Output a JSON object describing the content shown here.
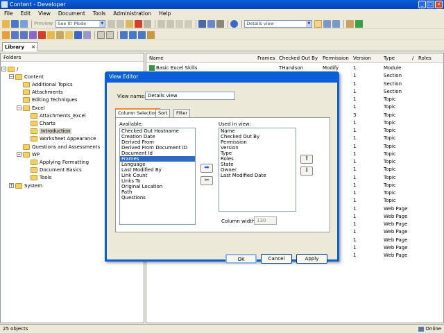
{
  "window": {
    "title": "Content - Developer"
  },
  "menu": [
    "File",
    "Edit",
    "View",
    "Document",
    "Tools",
    "Administration",
    "Help"
  ],
  "toolbar": {
    "preview_label": "Preview",
    "mode_value": "See It! Mode",
    "view_value": "Details view"
  },
  "library_tab": {
    "label": "Library",
    "close": "✕"
  },
  "left_pane": {
    "header": "Folders"
  },
  "tree": [
    {
      "label": "/",
      "depth": 0,
      "expander": "−"
    },
    {
      "label": "Content",
      "depth": 1,
      "expander": "−"
    },
    {
      "label": "Additional Topics",
      "depth": 2
    },
    {
      "label": "Attachments",
      "depth": 2
    },
    {
      "label": "Editing Techniques",
      "depth": 2
    },
    {
      "label": "Excel",
      "depth": 2,
      "expander": "−"
    },
    {
      "label": "Attachments_Excel",
      "depth": 3
    },
    {
      "label": "Charts",
      "depth": 3
    },
    {
      "label": "Introduction",
      "depth": 3,
      "selected": true
    },
    {
      "label": "Worksheet Appearance",
      "depth": 3
    },
    {
      "label": "Questions and Assessments",
      "depth": 2
    },
    {
      "label": "WP",
      "depth": 2,
      "expander": "−"
    },
    {
      "label": "Applying Formatting",
      "depth": 3
    },
    {
      "label": "Document Basics",
      "depth": 3
    },
    {
      "label": "Tools",
      "depth": 3
    },
    {
      "label": "System",
      "depth": 1,
      "expander": "+"
    }
  ],
  "columns": [
    "Name",
    "Frames",
    "Checked Out By",
    "Permission",
    "Version",
    "Type",
    "/",
    "Roles"
  ],
  "rows": [
    {
      "name": "Basic Excel Skills",
      "checked_out": "THandson",
      "permission": "Modify",
      "version": "1",
      "type": "Module"
    },
    {
      "version": "1",
      "type": "Section"
    },
    {
      "version": "1",
      "type": "Section"
    },
    {
      "version": "1",
      "type": "Section"
    },
    {
      "version": "1",
      "type": "Topic"
    },
    {
      "version": "1",
      "type": "Topic"
    },
    {
      "version": "3",
      "type": "Topic"
    },
    {
      "version": "1",
      "type": "Topic"
    },
    {
      "version": "1",
      "type": "Topic"
    },
    {
      "version": "1",
      "type": "Topic"
    },
    {
      "version": "1",
      "type": "Topic"
    },
    {
      "version": "1",
      "type": "Topic"
    },
    {
      "version": "1",
      "type": "Topic"
    },
    {
      "version": "1",
      "type": "Topic"
    },
    {
      "version": "1",
      "type": "Topic"
    },
    {
      "version": "1",
      "type": "Topic"
    },
    {
      "version": "1",
      "type": "Topic"
    },
    {
      "version": "1",
      "type": "Topic"
    },
    {
      "version": "1",
      "type": "Web Page"
    },
    {
      "version": "1",
      "type": "Web Page"
    },
    {
      "version": "1",
      "type": "Web Page"
    },
    {
      "version": "1",
      "type": "Web Page"
    },
    {
      "version": "1",
      "type": "Web Page"
    },
    {
      "version": "1",
      "type": "Web Page"
    },
    {
      "version": "1",
      "type": "Web Page"
    }
  ],
  "status": {
    "count": "25 objects",
    "state": "Online"
  },
  "dialog": {
    "title": "View Editor",
    "view_name_label": "View name:",
    "view_name_value": "Details view",
    "tabs": [
      "Column Selection",
      "Sort",
      "Filter"
    ],
    "available_label": "Available:",
    "available": [
      "Checked Out Hostname",
      "Creation Date",
      "Derived From",
      "Derived From Document ID",
      "Document Id",
      "Frames",
      "Language",
      "Last Modified By",
      "Link Count",
      "Links To",
      "Original Location",
      "Path",
      "Questions"
    ],
    "available_selected": "Frames",
    "used_label": "Used in view:",
    "used": [
      "Name",
      "Checked Out By",
      "Permission",
      "Version",
      "Type",
      "Roles",
      "State",
      "Owner",
      "Last Modified Date"
    ],
    "column_width_label": "Column width:",
    "column_width_value": "130",
    "ok": "OK",
    "cancel": "Cancel",
    "apply": "Apply"
  },
  "colors": {
    "title_blue": "#0a5fd8",
    "selection": "#316ac5",
    "folder": "#f2cf6a"
  }
}
